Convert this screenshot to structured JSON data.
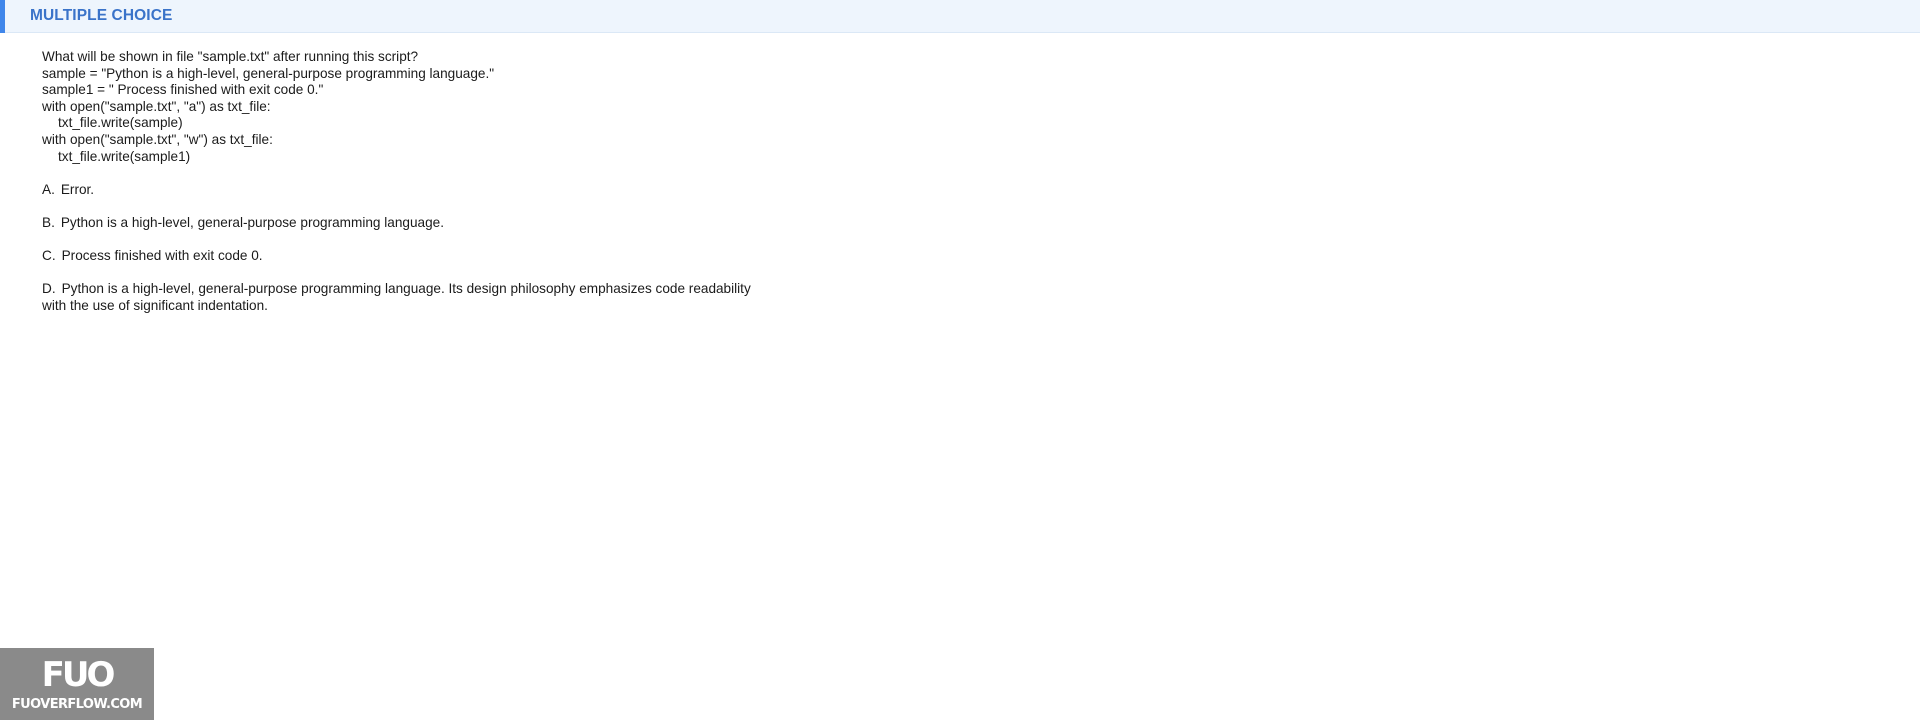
{
  "header": {
    "title": "MULTIPLE CHOICE",
    "accent_color": "#3f86ea",
    "title_color": "#3a73c9",
    "background_color": "#eef5fd"
  },
  "question": {
    "lines": [
      "What will be shown in file \"sample.txt\" after running this script?",
      "sample = \"Python is a high-level, general-purpose programming language.\"",
      "sample1 = \" Process finished with exit code 0.\"",
      "with open(\"sample.txt\", \"a\") as txt_file:",
      "txt_file.write(sample)",
      "with open(\"sample.txt\", \"w\") as txt_file:",
      "txt_file.write(sample1)"
    ]
  },
  "options": [
    {
      "letter": "A.",
      "text": "Error."
    },
    {
      "letter": "B.",
      "text": "Python is a high-level, general-purpose programming language."
    },
    {
      "letter": "C.",
      "text": "Process finished with exit code 0."
    },
    {
      "letter": "D.",
      "text": "Python is a high-level, general-purpose programming language. Its design philosophy emphasizes code readability with the use of significant indentation."
    }
  ],
  "watermark": {
    "mark": "FUO",
    "site": "FUOVERFLOW.COM"
  }
}
